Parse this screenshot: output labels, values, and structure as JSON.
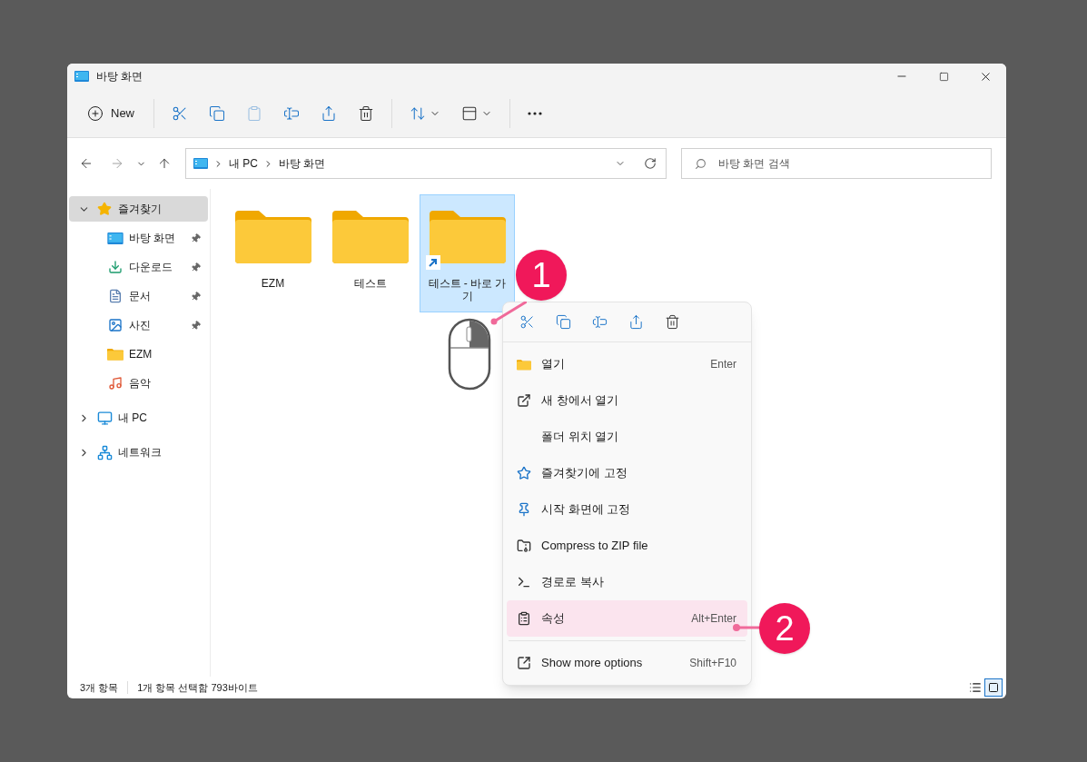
{
  "window": {
    "title": "바탕 화면"
  },
  "toolbar": {
    "buttons": [
      {
        "kind": "new",
        "label": "New",
        "disabled": false
      },
      {
        "kind": "cut",
        "disabled": false
      },
      {
        "kind": "copy",
        "disabled": false
      },
      {
        "kind": "paste",
        "disabled": true
      },
      {
        "kind": "rename",
        "disabled": false
      },
      {
        "kind": "share",
        "disabled": false
      },
      {
        "kind": "delete",
        "disabled": false
      },
      {
        "kind": "sort",
        "disabled": false
      },
      {
        "kind": "view",
        "disabled": false
      },
      {
        "kind": "more",
        "disabled": false
      }
    ]
  },
  "address": {
    "segments": [
      "내 PC",
      "바탕 화면"
    ]
  },
  "search": {
    "placeholder": "바탕 화면 검색"
  },
  "sidebar": {
    "items": [
      {
        "label": "즐겨찾기",
        "kind": "star",
        "expanded": true,
        "selected": true,
        "children": [
          {
            "label": "바탕 화면",
            "kind": "desktop",
            "pinned": true,
            "selected": false
          },
          {
            "label": "다운로드",
            "kind": "download",
            "pinned": true,
            "selected": false
          },
          {
            "label": "문서",
            "kind": "document",
            "pinned": true,
            "selected": false
          },
          {
            "label": "사진",
            "kind": "picture",
            "pinned": true,
            "selected": false
          },
          {
            "label": "EZM",
            "kind": "folder",
            "pinned": false,
            "selected": false
          },
          {
            "label": "음악",
            "kind": "music",
            "pinned": false,
            "selected": false
          }
        ]
      },
      {
        "label": "내 PC",
        "kind": "pc",
        "expanded": false,
        "selected": false
      },
      {
        "label": "네트워크",
        "kind": "network",
        "expanded": false,
        "selected": false
      }
    ]
  },
  "files": [
    {
      "name": "EZM",
      "selected": false,
      "shortcut": false
    },
    {
      "name": "테스트",
      "selected": false,
      "shortcut": false
    },
    {
      "name": "테스트 - 바로 가기",
      "selected": true,
      "shortcut": true
    }
  ],
  "context_menu": {
    "quick_actions": [
      {
        "kind": "cut"
      },
      {
        "kind": "copy"
      },
      {
        "kind": "rename"
      },
      {
        "kind": "share"
      },
      {
        "kind": "delete"
      }
    ],
    "items": [
      {
        "kind": "open",
        "label": "열기",
        "shortcut": "Enter",
        "highlighted": false
      },
      {
        "kind": "newwindow",
        "label": "새 창에서 열기",
        "highlighted": false
      },
      {
        "kind": "none",
        "label": "폴더 위치 열기",
        "highlighted": false
      },
      {
        "kind": "star",
        "label": "즐겨찾기에 고정",
        "highlighted": false
      },
      {
        "kind": "pin",
        "label": "시작 화면에 고정",
        "highlighted": false
      },
      {
        "kind": "zip",
        "label": "Compress to ZIP file",
        "highlighted": false
      },
      {
        "kind": "path",
        "label": "경로로 복사",
        "highlighted": false
      },
      {
        "kind": "properties",
        "label": "속성",
        "shortcut": "Alt+Enter",
        "highlighted": true
      },
      {
        "kind": "more",
        "label": "Show more options",
        "shortcut": "Shift+F10",
        "highlighted": false,
        "separator_before": true
      }
    ]
  },
  "status_bar": {
    "items": [
      "3개 항목",
      "1개 항목 선택함 793바이트"
    ],
    "views": [
      {
        "kind": "details",
        "selected": false
      },
      {
        "kind": "tiles",
        "selected": true
      }
    ]
  },
  "callouts": [
    "1",
    "2"
  ]
}
